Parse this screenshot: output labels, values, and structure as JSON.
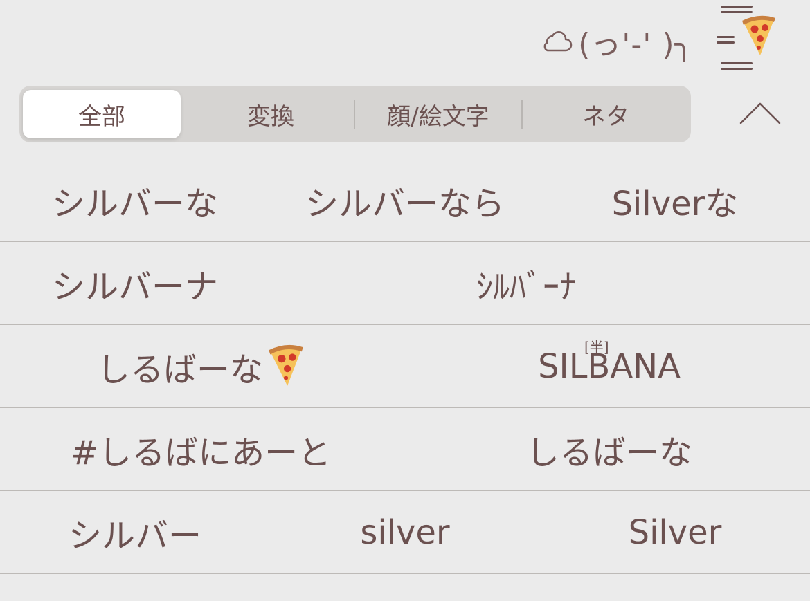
{
  "header": {
    "kaomoji": "(っ'-' )╮",
    "cloud_icon": "cloud-icon",
    "menu_icon": "pizza-menu-icon"
  },
  "tabs": [
    {
      "label": "全部",
      "active": true
    },
    {
      "label": "変換",
      "active": false
    },
    {
      "label": "顔/絵文字",
      "active": false
    },
    {
      "label": "ネタ",
      "active": false
    }
  ],
  "collapse_icon": "chevron-up-icon",
  "candidates": {
    "row1": [
      "シルバーな",
      "シルバーなら",
      "Silverな"
    ],
    "row2": [
      "シルバーナ",
      "ｼﾙﾊﾞｰﾅ"
    ],
    "row2_badge": "[半]",
    "row3": [
      "しるばーな",
      "SILBANA"
    ],
    "row4": [
      "#しるばにあーと",
      "しるばーな"
    ],
    "row5": [
      "シルバー",
      "silver",
      "Silver"
    ]
  },
  "colors": {
    "background": "#ebebeb",
    "text": "#6b5150",
    "segment_bg": "#d6d4d2",
    "segment_active": "#ffffff"
  }
}
